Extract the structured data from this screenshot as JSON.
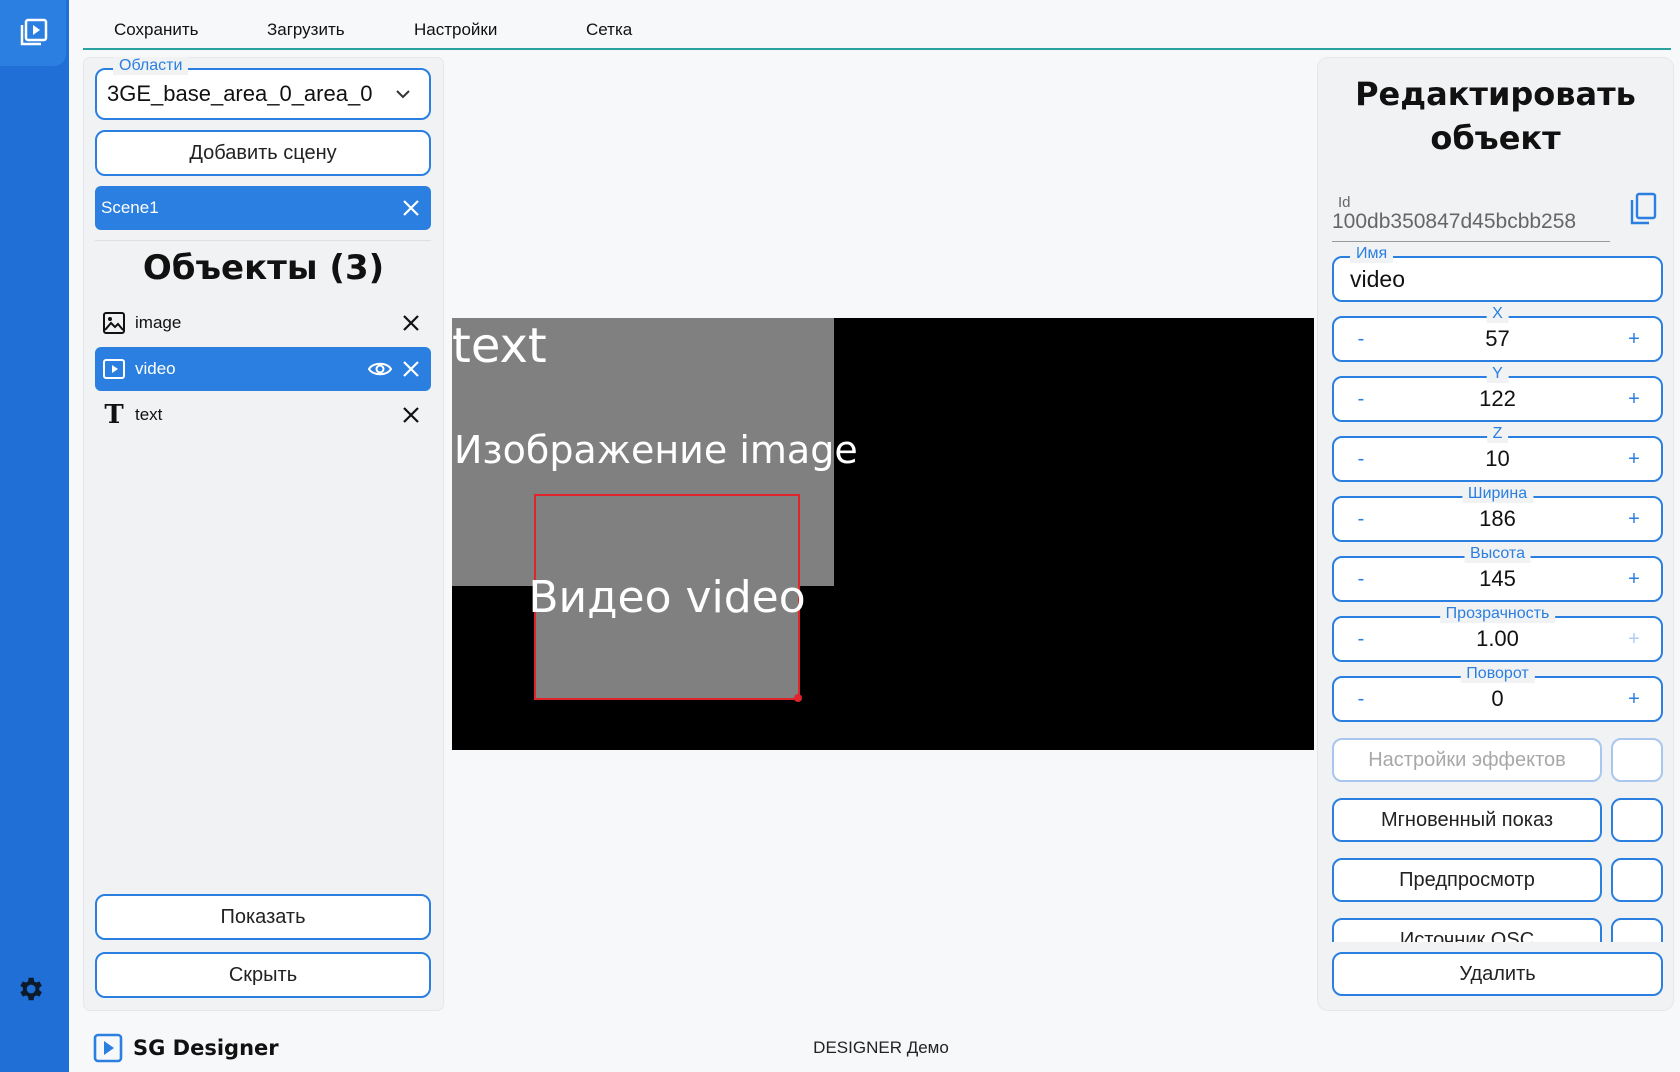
{
  "menu": {
    "save": "Сохранить",
    "load": "Загрузить",
    "settings": "Настройки",
    "grid": "Сетка"
  },
  "left": {
    "areas_legend": "Области",
    "areas_value": "3GE_base_area_0_area_0",
    "add_scene": "Добавить сцену",
    "scene": "Scene1",
    "objects_title": "Объекты (3)",
    "objects": [
      {
        "label": "image",
        "icon": "image-icon"
      },
      {
        "label": "video",
        "icon": "video-icon"
      },
      {
        "label": "text",
        "icon": "text-icon"
      }
    ],
    "show": "Показать",
    "hide": "Скрыть"
  },
  "canvas": {
    "text_label": "text",
    "image_label": "Изображение image",
    "video_label": "Видео video"
  },
  "right": {
    "title": "Редактировать объект",
    "id_label": "Id",
    "id_value": "100db350847d45bcbb258",
    "name_legend": "Имя",
    "name_value": "video",
    "fields": [
      {
        "label": "X",
        "value": "57"
      },
      {
        "label": "Y",
        "value": "122"
      },
      {
        "label": "Z",
        "value": "10"
      },
      {
        "label": "Ширина",
        "value": "186"
      },
      {
        "label": "Высота",
        "value": "145"
      },
      {
        "label": "Прозрачность",
        "value": "1.00"
      },
      {
        "label": "Поворот",
        "value": "0"
      }
    ],
    "minus": "-",
    "plus": "+",
    "effects": "Настройки эффектов",
    "instant": "Мгновенный показ",
    "preview": "Предпросмотр",
    "osc": "Источник OSC",
    "delete": "Удалить"
  },
  "footer": {
    "app_name": "SG Designer",
    "demo": "DESIGNER Демо"
  },
  "colors": {
    "accent": "#2a7fe0",
    "rail": "#1f6fd6",
    "selection": "#e0242a"
  }
}
